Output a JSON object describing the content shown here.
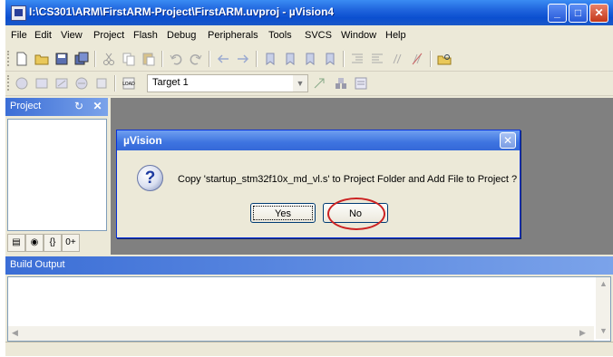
{
  "window": {
    "title": "I:\\CS301\\ARM\\FirstARM-Project\\FirstARM.uvproj - µVision4",
    "minimize_glyph": "_",
    "maximize_glyph": "□",
    "close_glyph": "✕"
  },
  "menu": [
    "File",
    "Edit",
    "View",
    "Project",
    "Flash",
    "Debug",
    "Peripherals",
    "Tools",
    "SVCS",
    "Window",
    "Help"
  ],
  "toolbar2": {
    "load_label": "LOAD",
    "target_value": "Target 1"
  },
  "project_panel": {
    "title": "Project",
    "tab_functions": "{}",
    "tab_templates": "0+"
  },
  "dialog": {
    "title": "µVision",
    "message": "Copy 'startup_stm32f10x_md_vl.s' to Project Folder and Add File to Project ?",
    "yes_label": "Yes",
    "no_label": "No",
    "icon": "question-icon"
  },
  "build_output": {
    "title": "Build Output"
  },
  "colors": {
    "titlebar": "#0b4fd0",
    "face": "#ece9d8",
    "mdi": "#808080",
    "highlight": "#cc2222"
  }
}
